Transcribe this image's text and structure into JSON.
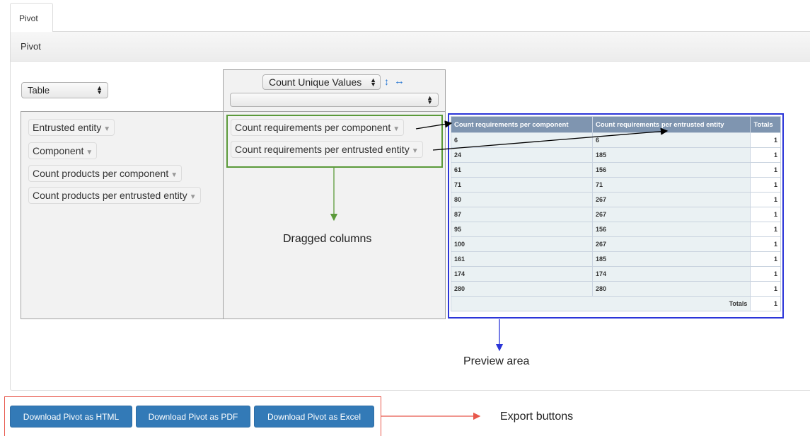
{
  "tab": {
    "label": "Pivot"
  },
  "panel": {
    "title": "Pivot"
  },
  "renderer": {
    "selected": "Table"
  },
  "aggregator": {
    "selected": "Count Unique Values",
    "attr_selected": "",
    "sort_rows_icon": "↕",
    "sort_cols_icon": "↔"
  },
  "unused_attrs": [
    "Entrusted entity",
    "Component",
    "Count products per component",
    "Count products per entrusted entity"
  ],
  "row_attrs": [
    "Count requirements per component",
    "Count requirements per entrusted entity"
  ],
  "annotations": {
    "dragged": "Dragged columns",
    "preview": "Preview area",
    "export": "Export buttons"
  },
  "colors": {
    "dragged_arrow": "#5b9a3a",
    "preview_box": "#2b35d8",
    "export_box": "#e8584c"
  },
  "table": {
    "headers": [
      "Count requirements per component",
      "Count requirements per entrusted entity",
      "Totals"
    ],
    "rows": [
      [
        "6",
        "6",
        "1"
      ],
      [
        "24",
        "185",
        "1"
      ],
      [
        "61",
        "156",
        "1"
      ],
      [
        "71",
        "71",
        "1"
      ],
      [
        "80",
        "267",
        "1"
      ],
      [
        "87",
        "267",
        "1"
      ],
      [
        "95",
        "156",
        "1"
      ],
      [
        "100",
        "267",
        "1"
      ],
      [
        "161",
        "185",
        "1"
      ],
      [
        "174",
        "174",
        "1"
      ],
      [
        "280",
        "280",
        "1"
      ]
    ],
    "totals_label": "Totals",
    "totals_value": "1"
  },
  "buttons": {
    "html": "Download Pivot as HTML",
    "pdf": "Download Pivot as PDF",
    "excel": "Download Pivot as Excel"
  }
}
